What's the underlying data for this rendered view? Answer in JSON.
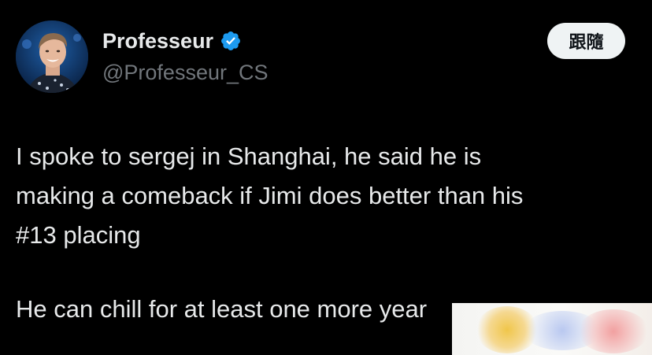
{
  "tweet": {
    "author": {
      "display_name": "Professeur",
      "handle": "@Professeur_CS",
      "verified_icon": "verified-badge-icon",
      "verified_color": "#1d9bf0"
    },
    "follow_label": "跟隨",
    "text_lines": [
      "I spoke to sergej in Shanghai, he said he is",
      "making a comeback if Jimi does better than his",
      "#13 placing",
      "He can chill for at least one more year"
    ]
  },
  "colors": {
    "background": "#000000",
    "text_primary": "#e7e9ea",
    "text_secondary": "#71767b",
    "button_bg": "#eff3f4",
    "button_text": "#0f1419"
  }
}
